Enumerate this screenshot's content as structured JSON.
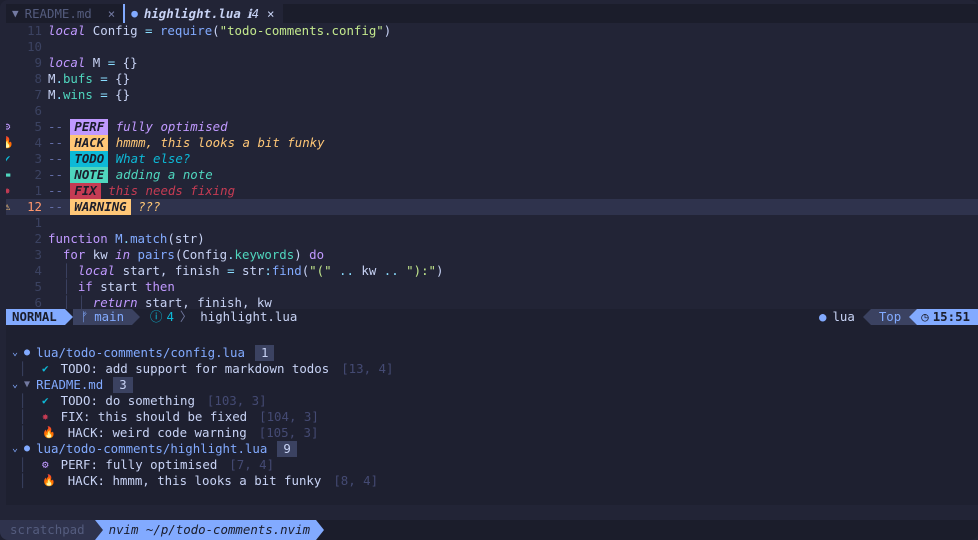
{
  "tabs": [
    {
      "icon": "markdown-icon",
      "label": "README.md",
      "close": "×",
      "active": false
    },
    {
      "icon": "lua-icon",
      "label": "highlight.lua",
      "badge": "4",
      "close": "×",
      "active": true
    }
  ],
  "code": {
    "lines": [
      {
        "num": "11",
        "parts": [
          [
            "kw",
            "local"
          ],
          [
            "var",
            " Config "
          ],
          [
            "dot",
            "="
          ],
          [
            "var",
            " "
          ],
          [
            "fn",
            "require"
          ],
          [
            "var",
            "("
          ],
          [
            "str",
            "\"todo-comments.config\""
          ],
          [
            "var",
            ")"
          ]
        ]
      },
      {
        "num": "10",
        "parts": []
      },
      {
        "num": "9",
        "parts": [
          [
            "kw",
            "local"
          ],
          [
            "var",
            " M "
          ],
          [
            "dot",
            "="
          ],
          [
            "var",
            " {}"
          ]
        ]
      },
      {
        "num": "8",
        "parts": [
          [
            "var",
            "M"
          ],
          [
            "dot",
            "."
          ],
          [
            "prop",
            "bufs"
          ],
          [
            "var",
            " "
          ],
          [
            "dot",
            "="
          ],
          [
            "var",
            " {}"
          ]
        ]
      },
      {
        "num": "7",
        "parts": [
          [
            "var",
            "M"
          ],
          [
            "dot",
            "."
          ],
          [
            "prop",
            "wins"
          ],
          [
            "var",
            " "
          ],
          [
            "dot",
            "="
          ],
          [
            "var",
            " {}"
          ]
        ]
      },
      {
        "num": "6",
        "parts": []
      },
      {
        "num": "5",
        "sign": "perf",
        "todo": {
          "tag": "PERF",
          "tagcolor": "#c099ff",
          "text": "fully optimised"
        }
      },
      {
        "num": "4",
        "sign": "fire",
        "todo": {
          "tag": "HACK",
          "tagcolor": "#ffc777",
          "text": "hmmm, this looks a bit funky"
        }
      },
      {
        "num": "3",
        "sign": "check",
        "todo": {
          "tag": "TODO",
          "tagcolor": "#0db9d7",
          "text": "What else?"
        }
      },
      {
        "num": "2",
        "sign": "note",
        "todo": {
          "tag": "NOTE",
          "tagcolor": "#4fd6be",
          "text": "adding a note"
        }
      },
      {
        "num": "1",
        "sign": "bug",
        "todo": {
          "tag": "FIX",
          "tagcolor": "#c53b53",
          "text": "this needs fixing"
        }
      },
      {
        "num": "12",
        "sign": "warn",
        "cursor": true,
        "todo": {
          "tag": "WARNING",
          "tagcolor": "#ffc777",
          "text": "???"
        }
      },
      {
        "num": "1",
        "parts": []
      },
      {
        "num": "2",
        "parts": [
          [
            "kw2",
            "function"
          ],
          [
            "var",
            " "
          ],
          [
            "fn",
            "M"
          ],
          [
            "dot",
            "."
          ],
          [
            "fn",
            "match"
          ],
          [
            "var",
            "("
          ],
          [
            "var",
            "str"
          ],
          [
            "var",
            ")"
          ]
        ]
      },
      {
        "num": "3",
        "parts": [
          [
            "guide",
            "  "
          ],
          [
            "kw2",
            "for"
          ],
          [
            "var",
            " kw "
          ],
          [
            "kw",
            "in"
          ],
          [
            "var",
            " "
          ],
          [
            "fn",
            "pairs"
          ],
          [
            "var",
            "(Config"
          ],
          [
            "dot",
            "."
          ],
          [
            "prop",
            "keywords"
          ],
          [
            "var",
            ") "
          ],
          [
            "kw2",
            "do"
          ]
        ]
      },
      {
        "num": "4",
        "parts": [
          [
            "guide",
            "  │ "
          ],
          [
            "kw",
            "local"
          ],
          [
            "var",
            " start, finish "
          ],
          [
            "dot",
            "="
          ],
          [
            "var",
            " str"
          ],
          [
            "dot",
            ":"
          ],
          [
            "fn",
            "find"
          ],
          [
            "var",
            "("
          ],
          [
            "str",
            "\"(\""
          ],
          [
            "var",
            " "
          ],
          [
            "dot",
            ".."
          ],
          [
            "var",
            " kw "
          ],
          [
            "dot",
            ".."
          ],
          [
            "var",
            " "
          ],
          [
            "str",
            "\"):\""
          ],
          [
            "var",
            ")"
          ]
        ]
      },
      {
        "num": "5",
        "parts": [
          [
            "guide",
            "  │ "
          ],
          [
            "kw2",
            "if"
          ],
          [
            "var",
            " start "
          ],
          [
            "kw2",
            "then"
          ]
        ]
      },
      {
        "num": "6",
        "parts": [
          [
            "guide",
            "  │ │ "
          ],
          [
            "kw",
            "return"
          ],
          [
            "var",
            " start, finish, kw"
          ]
        ]
      }
    ]
  },
  "statusline": {
    "mode": "NORMAL",
    "branch": "main",
    "diag_count": "4",
    "sep": "〉",
    "filename": "highlight.lua",
    "filetype": "lua",
    "position": "Top",
    "time": "15:51"
  },
  "trouble": {
    "groups": [
      {
        "icon": "lua-icon",
        "path": "lua/todo-comments/config.lua",
        "count": "1",
        "items": [
          {
            "icon": "check",
            "text": "TODO: add support for markdown todos",
            "loc": "[13, 4]"
          }
        ]
      },
      {
        "icon": "markdown-icon",
        "path": "README.md",
        "count": "3",
        "items": [
          {
            "icon": "check",
            "text": "TODO: do something",
            "loc": "[103, 3]"
          },
          {
            "icon": "bug",
            "text": "FIX: this should be fixed",
            "loc": "[104, 3]"
          },
          {
            "icon": "fire",
            "text": "HACK: weird code warning",
            "loc": "[105, 3]"
          }
        ]
      },
      {
        "icon": "lua-icon",
        "path": "lua/todo-comments/highlight.lua",
        "count": "9",
        "items": [
          {
            "icon": "perf",
            "text": "PERF: fully optimised",
            "loc": "[7, 4]"
          },
          {
            "icon": "fire",
            "text": "HACK: hmmm, this looks a bit funky",
            "loc": "[8, 4]"
          }
        ]
      }
    ]
  },
  "tmux": {
    "session": "scratchpad",
    "window": "nvim ~/p/todo-comments.nvim"
  },
  "colors": {
    "background": "#222436",
    "accent": "#82aaff",
    "perf": "#c099ff",
    "hack": "#ffc777",
    "todo": "#0db9d7",
    "note": "#4fd6be",
    "fix": "#c53b53",
    "warning": "#ffc777"
  }
}
